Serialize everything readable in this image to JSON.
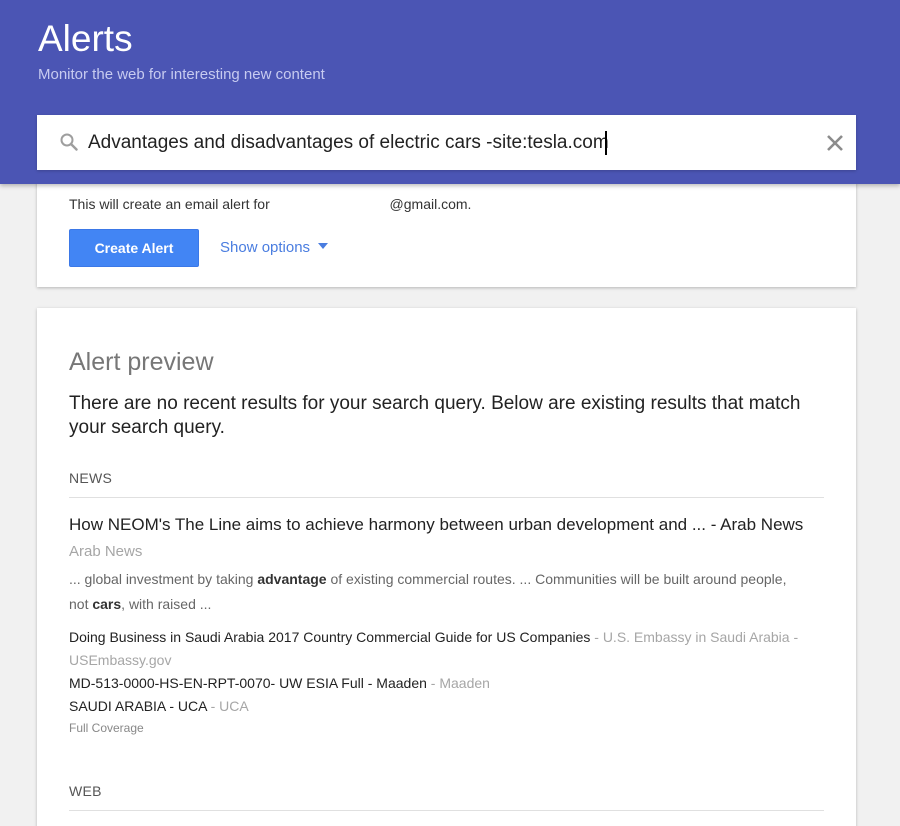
{
  "header": {
    "title": "Alerts",
    "subtitle": "Monitor the web for interesting new content"
  },
  "search": {
    "value": "Advantages and disadvantages of electric cars -site:tesla.com",
    "search_icon": "search-icon",
    "clear_icon": "close-icon"
  },
  "alert_setup": {
    "email_prefix": "This will create an email alert for",
    "email_suffix": "@gmail.com.",
    "create_button": "Create Alert",
    "show_options": "Show options"
  },
  "preview": {
    "title": "Alert preview",
    "message": "There are no recent results for your search query. Below are existing results that match your search query.",
    "news_label": "NEWS",
    "top_story": {
      "title": "How NEOM's The Line aims to achieve harmony between urban development and ... - Arab News",
      "source": "Arab News",
      "snippet_1": "... global investment by taking ",
      "snippet_bold_1": "advantage",
      "snippet_2": " of existing commercial routes. ... Communities will be built around people, not ",
      "snippet_bold_2": "cars",
      "snippet_3": ", with raised ..."
    },
    "related": [
      {
        "title": "Doing Business in Saudi Arabia 2017 Country Commercial Guide for US Companies",
        "source": " - U.S. Embassy in Saudi Arabia - USEmbassy.gov"
      },
      {
        "title": "MD-513-0000-HS-EN-RPT-0070- UW ESIA Full - Maaden",
        "source": " - Maaden"
      },
      {
        "title": "SAUDI ARABIA - UCA",
        "source": " - UCA"
      }
    ],
    "full_coverage": "Full Coverage",
    "web_label": "WEB"
  },
  "colors": {
    "header_bg": "#4b55b4",
    "button_bg": "#4285f4",
    "link": "#4a7de0"
  }
}
